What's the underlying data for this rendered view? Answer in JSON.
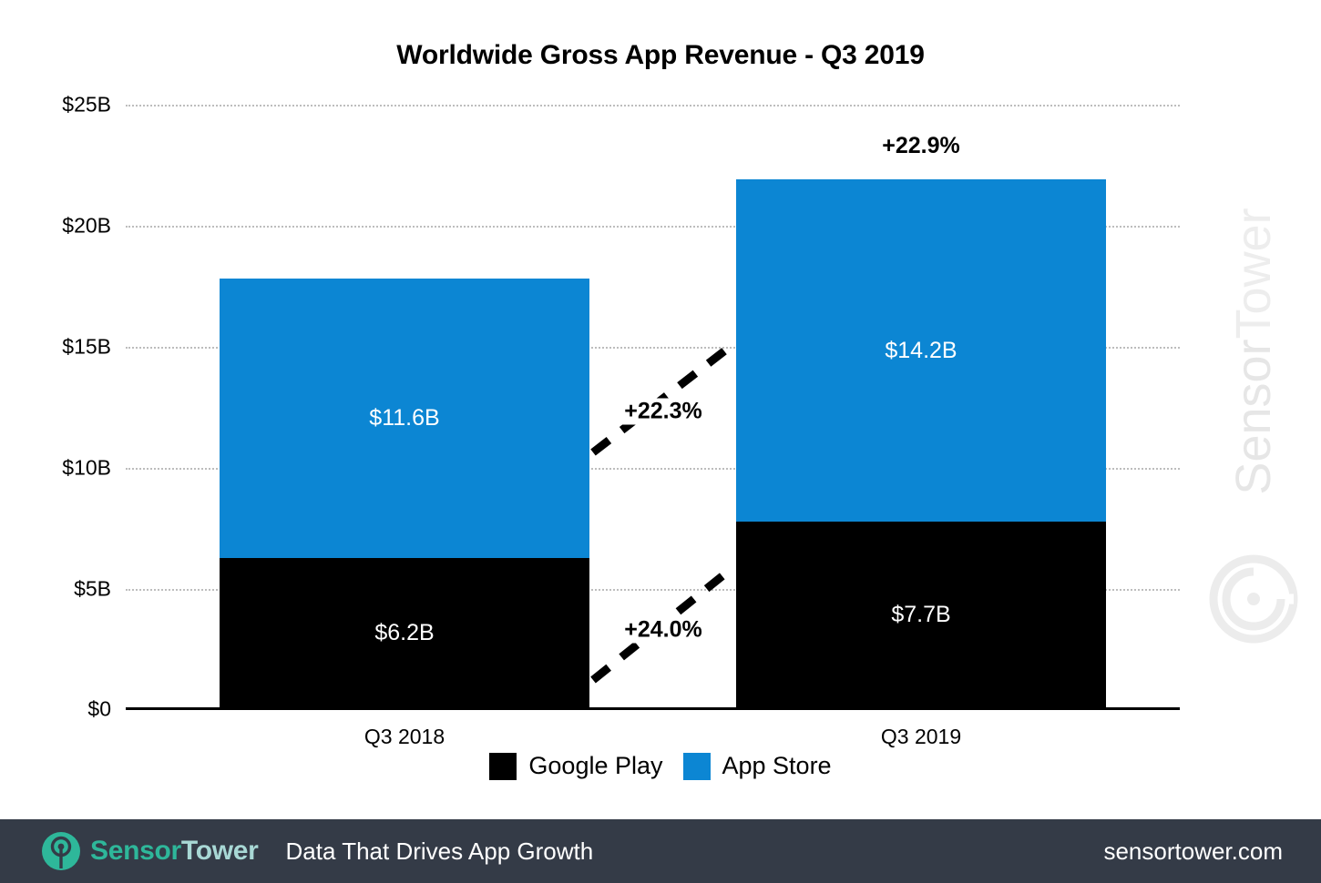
{
  "chart_data": {
    "type": "bar",
    "subtype": "stacked-bar",
    "title": "Worldwide Gross App Revenue - Q3 2019",
    "xlabel": "",
    "ylabel": "",
    "categories": [
      "Q3 2018",
      "Q3 2019"
    ],
    "ylim": [
      0,
      25
    ],
    "y_unit": "B",
    "y_prefix": "$",
    "yticks": [
      0,
      5,
      10,
      15,
      20,
      25
    ],
    "ytick_labels": [
      "$0",
      "$5B",
      "$10B",
      "$15B",
      "$20B",
      "$25B"
    ],
    "grid": true,
    "grid_style": "dotted",
    "legend_position": "bottom-center",
    "series": [
      {
        "name": "Google Play",
        "color": "#000000",
        "values": [
          6.2,
          7.7
        ],
        "value_labels": [
          "$6.2B",
          "$7.7B"
        ],
        "growth_label": "+24.0%"
      },
      {
        "name": "App Store",
        "color": "#0c86d3",
        "values": [
          11.6,
          14.2
        ],
        "value_labels": [
          "$11.6B",
          "$14.2B"
        ],
        "growth_label": "+22.3%"
      }
    ],
    "totals": [
      17.8,
      21.9
    ],
    "annotations": [
      {
        "text": "+22.9%",
        "kind": "total-growth",
        "anchor": "above-bar-2"
      },
      {
        "text": "+22.3%",
        "kind": "series-growth",
        "anchor": "app-store-between-bars"
      },
      {
        "text": "+24.0%",
        "kind": "series-growth",
        "anchor": "google-play-between-bars"
      }
    ]
  },
  "chart": {
    "title": "Worldwide Gross App Revenue - Q3 2019",
    "ytick_labels": [
      "$25B",
      "$20B",
      "$15B",
      "$10B",
      "$5B",
      "$0"
    ],
    "xtick_labels": [
      "Q3 2018",
      "Q3 2019"
    ],
    "bars": [
      {
        "category": "Q3 2018",
        "app_store_label": "$11.6B",
        "google_play_label": "$6.2B",
        "total_growth_label": ""
      },
      {
        "category": "Q3 2019",
        "app_store_label": "$14.2B",
        "google_play_label": "$7.7B",
        "total_growth_label": "+22.9%"
      }
    ],
    "growth_app_store": "+22.3%",
    "growth_google_play": "+24.0%"
  },
  "legend": {
    "items": [
      {
        "label": "Google Play",
        "color": "#000000"
      },
      {
        "label": "App Store",
        "color": "#0c86d3"
      }
    ]
  },
  "watermark": {
    "brand_first": "Sensor",
    "brand_second": "Tower",
    "logo_icon": "sensortower-target-icon"
  },
  "footer": {
    "brand_first": "Sensor",
    "brand_second": "Tower",
    "logo_icon": "sensortower-target-icon",
    "tagline": "Data That Drives App Growth",
    "url": "sensortower.com",
    "background_color": "#343b47",
    "accent_color": "#2eb79a"
  },
  "colors": {
    "app_store": "#0c86d3",
    "google_play": "#000000",
    "grid": "#bdbdbd",
    "footer_bg": "#343b47",
    "brand_teal": "#2eb79a"
  }
}
